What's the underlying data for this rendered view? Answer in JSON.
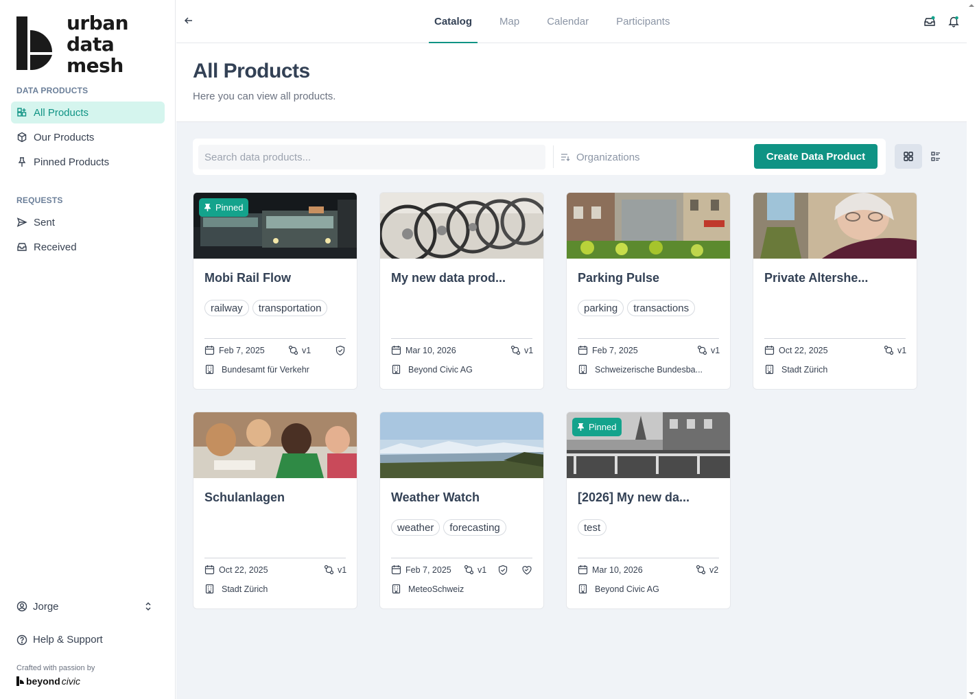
{
  "brand": {
    "line1": "urban",
    "line2": "data",
    "line3": "mesh"
  },
  "sidebar": {
    "data_products_label": "DATA PRODUCTS",
    "requests_label": "REQUESTS",
    "items": [
      {
        "label": "All Products",
        "icon": "grid-plus-icon"
      },
      {
        "label": "Our Products",
        "icon": "package-icon"
      },
      {
        "label": "Pinned Products",
        "icon": "pin-icon"
      },
      {
        "label": "Sent",
        "icon": "send-icon"
      },
      {
        "label": "Received",
        "icon": "inbox-icon"
      }
    ],
    "user": "Jorge",
    "help": "Help & Support",
    "crafted": "Crafted with passion by",
    "footer_brand_bold": "beyond",
    "footer_brand_italic": "civic"
  },
  "topbar": {
    "tabs": [
      "Catalog",
      "Map",
      "Calendar",
      "Participants"
    ],
    "active_tab": "Catalog"
  },
  "header": {
    "title": "All Products",
    "subtitle": "Here you can view all products."
  },
  "toolbar": {
    "search_placeholder": "Search data products...",
    "org_filter": "Organizations",
    "create_label": "Create Data Product"
  },
  "pinned_label": "Pinned",
  "colors": {
    "accent": "#0f9384",
    "accent_light": "#d5f5ee",
    "pinned_badge": "#14a38c",
    "main_bg": "#f0f3f7"
  },
  "cards": [
    {
      "title": "Mobi Rail Flow",
      "tags": [
        "railway",
        "transportation"
      ],
      "date": "Feb 7, 2025",
      "version": "v1",
      "org": "Bundesamt für Verkehr",
      "pinned": true,
      "image": "tram-night"
    },
    {
      "title": "My new data prod...",
      "tags": [],
      "date": "Mar 10, 2026",
      "version": "v1",
      "org": "Beyond Civic AG",
      "pinned": false,
      "image": "bicycles"
    },
    {
      "title": "Parking Pulse",
      "tags": [
        "parking",
        "transactions"
      ],
      "date": "Feb 7, 2025",
      "version": "v1",
      "org": "Schweizerische Bundesba...",
      "pinned": false,
      "image": "street-view"
    },
    {
      "title": "Private Altershe...",
      "tags": [],
      "date": "Oct 22, 2025",
      "version": "v1",
      "org": "Stadt Zürich",
      "pinned": false,
      "image": "elderly-woman"
    },
    {
      "title": "Schulanlagen",
      "tags": [],
      "date": "Oct 22, 2025",
      "version": "v1",
      "org": "Stadt Zürich",
      "pinned": false,
      "image": "classroom"
    },
    {
      "title": "Weather Watch",
      "tags": [
        "weather",
        "forecasting"
      ],
      "date": "Feb 7, 2025",
      "version": "v1",
      "org": "MeteoSchweiz",
      "pinned": false,
      "image": "landscape"
    },
    {
      "title": "[2026] My new da...",
      "tags": [
        "test"
      ],
      "date": "Mar 10, 2026",
      "version": "v2",
      "org": "Beyond Civic AG",
      "pinned": true,
      "image": "bw-square"
    }
  ]
}
